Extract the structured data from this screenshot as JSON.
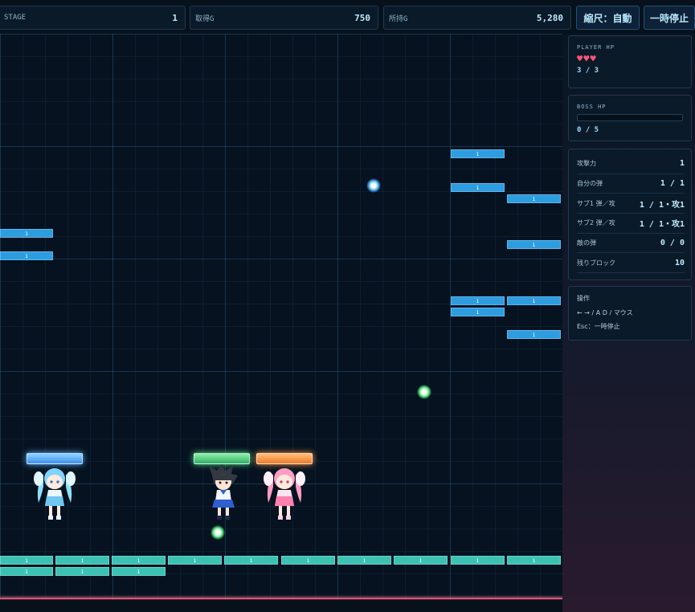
{
  "header": {
    "stage_label": "STAGE",
    "stage_value": "1",
    "earned_label": "取得G",
    "earned_value": "750",
    "owned_label": "所持G",
    "owned_value": "5,280",
    "scale_button": "縮尺：自動",
    "pause_button": "一時停止"
  },
  "player_hp": {
    "label": "PLAYER HP",
    "hearts": "♥♥♥",
    "value": "3 / 3"
  },
  "boss_hp": {
    "label": "BOSS HP",
    "value": "0 / 5",
    "fraction": 0
  },
  "stats": [
    {
      "key": "攻撃力",
      "value": "1"
    },
    {
      "key": "自分の弾",
      "value": "1 / 1"
    },
    {
      "key": "サブ1 弾／攻",
      "value": "1 / 1・攻1"
    },
    {
      "key": "サブ2 弾／攻",
      "value": "1 / 1・攻1"
    },
    {
      "key": "敵の弾",
      "value": "0 / 0"
    },
    {
      "key": "残りブロック",
      "value": "10"
    }
  ],
  "controls": {
    "title": "操作",
    "line1": "← → / A D / マウス",
    "line2": "Esc：一時停止"
  },
  "blocks": [
    {
      "color": "blue",
      "hp": "1"
    },
    {
      "color": "blue",
      "hp": "1"
    },
    {
      "color": "blue",
      "hp": "1"
    },
    {
      "color": "blue",
      "hp": "1"
    },
    {
      "color": "blue",
      "hp": "1"
    },
    {
      "color": "blue",
      "hp": "1"
    },
    {
      "color": "blue",
      "hp": "1"
    },
    {
      "color": "blue",
      "hp": "1"
    },
    {
      "color": "blue",
      "hp": "1"
    },
    {
      "color": "blue",
      "hp": "1"
    },
    {
      "color": "teal",
      "hp": "1"
    },
    {
      "color": "teal",
      "hp": "1"
    },
    {
      "color": "teal",
      "hp": "1"
    },
    {
      "color": "teal",
      "hp": "1"
    },
    {
      "color": "teal",
      "hp": "1"
    },
    {
      "color": "teal",
      "hp": "1"
    },
    {
      "color": "teal",
      "hp": "1"
    },
    {
      "color": "teal",
      "hp": "1"
    },
    {
      "color": "teal",
      "hp": "1"
    },
    {
      "color": "teal",
      "hp": "1"
    },
    {
      "color": "teal",
      "hp": "1"
    },
    {
      "color": "teal",
      "hp": "1"
    },
    {
      "color": "teal",
      "hp": "1"
    }
  ],
  "colors": {
    "accent": "#9fdcff",
    "block_blue": "#2d9de0",
    "block_teal": "#3cc2b3",
    "heart": "#ff5577",
    "deadline": "#e0566e"
  }
}
